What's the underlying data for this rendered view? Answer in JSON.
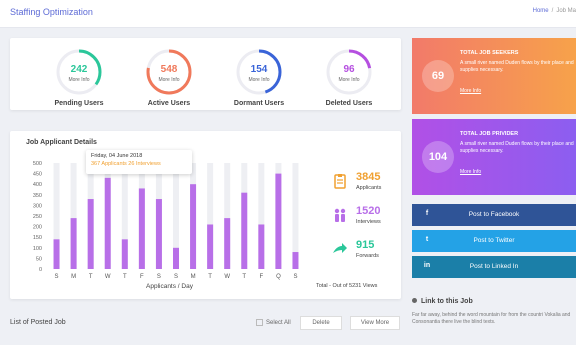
{
  "header": {
    "title": "Staffing Optimization",
    "breadcrumb_home": "Home",
    "breadcrumb_sep": "/",
    "breadcrumb_current": "Job Ma"
  },
  "stats": [
    {
      "value": "242",
      "more": "More Info",
      "label": "Pending Users",
      "color": "#2bc79a",
      "progress": 0.35
    },
    {
      "value": "548",
      "more": "More Info",
      "label": "Active Users",
      "color": "#f0795b",
      "progress": 0.78
    },
    {
      "value": "154",
      "more": "More Info",
      "label": "Dormant Users",
      "color": "#3a64d8",
      "progress": 0.45
    },
    {
      "value": "96",
      "more": "More Info",
      "label": "Deleted Users",
      "color": "#b54fe0",
      "progress": 0.22
    }
  ],
  "chart_title": "Job Applicant Details",
  "tooltip": {
    "date": "Friday, 04 June 2018",
    "value": "367 Applicants 26 Interviews"
  },
  "chart_data": {
    "type": "bar",
    "categories": [
      "S",
      "M",
      "T",
      "W",
      "T",
      "F",
      "S",
      "S",
      "M",
      "T",
      "W",
      "T",
      "F",
      "Q",
      "S"
    ],
    "values": [
      140,
      240,
      330,
      430,
      140,
      380,
      330,
      100,
      400,
      210,
      240,
      360,
      210,
      450,
      80
    ],
    "ylim": [
      0,
      500
    ],
    "yticks": [
      0,
      50,
      100,
      150,
      200,
      250,
      300,
      350,
      400,
      450,
      500
    ],
    "xlabel": "Applicants / Day",
    "bar_color": "#b86fe8",
    "track_color": "#eeeff3"
  },
  "legend": [
    {
      "value": "3845",
      "label": "Applicants",
      "color": "#f0a030",
      "icon": "clipboard-icon"
    },
    {
      "value": "1520",
      "label": "Interviews",
      "color": "#b86fe8",
      "icon": "people-icon"
    },
    {
      "value": "915",
      "label": "Forwards",
      "color": "#2bc79a",
      "icon": "forward-arrow-icon"
    }
  ],
  "chart_total": "Total - Out of 5231 Views",
  "seekers": {
    "value": "69",
    "title": "TOTAL JOB SEEKERS",
    "text": "A small river named Duden flows by their place and supplies necessary.",
    "link": "More Info"
  },
  "provider": {
    "value": "104",
    "title": "TOTAL JOB PRIVIDER",
    "text": "A small river named Duden flows by their place and supplies necessary.",
    "link": "More Info"
  },
  "social": {
    "facebook": "Post to Facebook",
    "twitter": "Post to Twitter",
    "linkedin": "Post to Linked In",
    "fb_icon": "f",
    "tw_icon": "t",
    "li_icon": "in"
  },
  "link_job": {
    "title": "Link to this Job",
    "text": "Far far away, behind the word mountain for from the countri Vokalia and Consonantia there live the blind texts."
  },
  "posted": {
    "title": "List of Posted Job",
    "select_all": "Select All",
    "delete": "Delete",
    "view_more": "View More"
  }
}
